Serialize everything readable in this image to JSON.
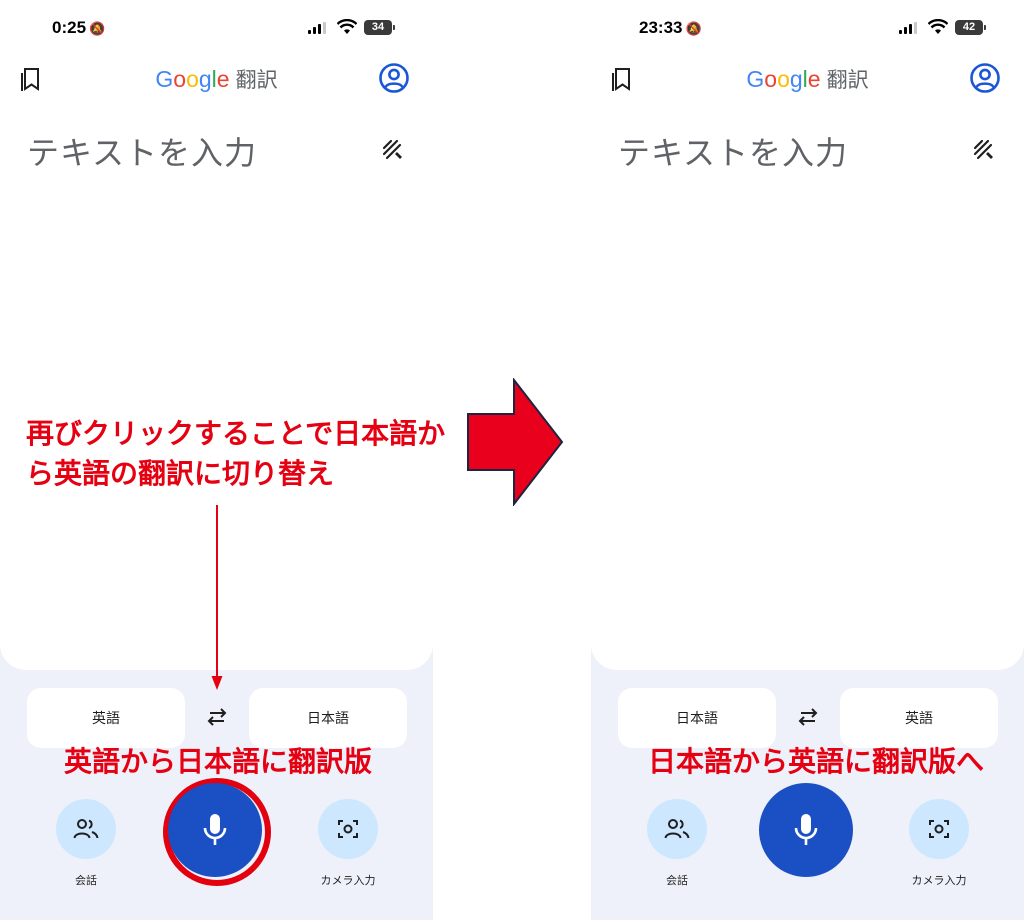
{
  "left": {
    "status": {
      "time": "0:25",
      "battery": "34"
    },
    "app": {
      "title_parts": [
        "G",
        "o",
        "o",
        "g",
        "l",
        "e"
      ],
      "title_suffix": "翻訳"
    },
    "input": {
      "placeholder": "テキストを入力"
    },
    "languages": {
      "source": "英語",
      "target": "日本語"
    },
    "buttons": {
      "conversation": "会話",
      "camera": "カメラ入力"
    }
  },
  "right": {
    "status": {
      "time": "23:33",
      "battery": "42"
    },
    "app": {
      "title_parts": [
        "G",
        "o",
        "o",
        "g",
        "l",
        "e"
      ],
      "title_suffix": "翻訳"
    },
    "input": {
      "placeholder": "テキストを入力"
    },
    "languages": {
      "source": "日本語",
      "target": "英語"
    },
    "buttons": {
      "conversation": "会話",
      "camera": "カメラ入力"
    }
  },
  "annotations": {
    "top_line1": "再びクリックすることで日本語か",
    "top_line2": "ら英語の翻訳に切り替え",
    "left_caption": "英語から日本語に翻訳版",
    "right_caption": "日本語から英語に翻訳版へ"
  },
  "colors": {
    "mic_button": "#1b4fc4",
    "accent_circle": "#cde7ff",
    "annotation_red": "#e50012",
    "panel_bg": "#eef1f9"
  }
}
